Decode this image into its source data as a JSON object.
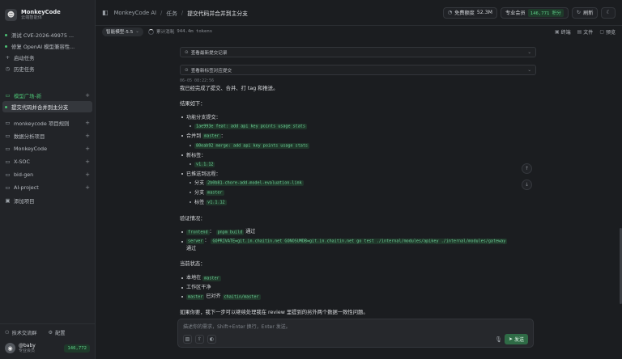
{
  "brand": {
    "name": "MonkeyCode",
    "sub": "云端智能体"
  },
  "sidebar": {
    "tasks": [
      {
        "label": "测试 CVE-2026-49975 ..."
      },
      {
        "label": "修复 OpenAI 模型兼容性..."
      }
    ],
    "start_task": "启动任务",
    "history": "历史任务",
    "group_title": "模型广场-新",
    "group_active_item": "提交代码并合并到主分支",
    "projects": [
      {
        "label": "monkeycode 项目规则"
      },
      {
        "label": "数据分析项目"
      },
      {
        "label": "MonkeyCode"
      },
      {
        "label": "X-SOC"
      },
      {
        "label": "bid-gen"
      },
      {
        "label": "AI-project"
      }
    ],
    "add_project": "添加项目",
    "footer": {
      "community": "技术交流群",
      "settings": "配置",
      "user_name": "@baby",
      "user_role": "专业会员",
      "credits": "146,772"
    }
  },
  "topbar": {
    "crumbs": [
      "MonkeyCode AI",
      "任务",
      "提交代码并合并到主分支"
    ],
    "free_quota_label": "免费额度",
    "free_quota_value": "52.3M",
    "member_label": "专业会员",
    "member_points": "146,771 积分",
    "refresh": "刷新"
  },
  "toolbar": {
    "model": "智能模型-5.5",
    "tokens_label": "累计消耗",
    "tokens_value": "944.4m tokens",
    "terminal": "终端",
    "files": "文件",
    "preview": "预览"
  },
  "message": {
    "collapse1": "查看最新提交记录",
    "collapse2": "查看新标签对应提交",
    "timestamp": "06-05 08:22:56",
    "intro": "我已经完成了提交、合并、打 tag 和推送。",
    "results_title": "结果如下：",
    "feature_branch_label": "功能分支提交：",
    "feature_commit": "1ae993e feat: add api key points usage stats",
    "merged_to_label": "合并到",
    "merged_to_branch": "master",
    "merge_commit": "80eab92 merge: add api key points usage stats",
    "new_tag_label": "新标签：",
    "new_tag": "v1.1.12",
    "pushed_label": "已推送到远程：",
    "branch_word": "分支",
    "pushed_branch1": "2b0b81-chore-add-model-evaluation-link",
    "pushed_branch2": "master",
    "tag_word": "标签",
    "pushed_tag": "v1.1.12",
    "verify_title": "验证情况：",
    "verify_frontend_tag": "frontend",
    "verify_frontend_cmd": "pnpm build",
    "verify_pass": "通过",
    "verify_server_tag": "server",
    "verify_server_cmd": "GOPRIVATE=git.in.chaitin.net GONOSUMDB=git.in.chaitin.net go test ./internal/modules/apikey ./internal/modules/gateway",
    "current_title": "当前状态：",
    "local_at": "本地在",
    "local_branch": "master",
    "clean": "工作区干净",
    "aligned_local": "master",
    "aligned_text": "已对齐",
    "aligned_remote": "chaitin/master",
    "closing": "如果你要，我下一步可以继续处理我在 review 里提到的另外两个数据一致性问题。"
  },
  "composer": {
    "placeholder": "描述你的需求，Shift+Enter 换行，Enter 发送。",
    "send": "发送"
  }
}
